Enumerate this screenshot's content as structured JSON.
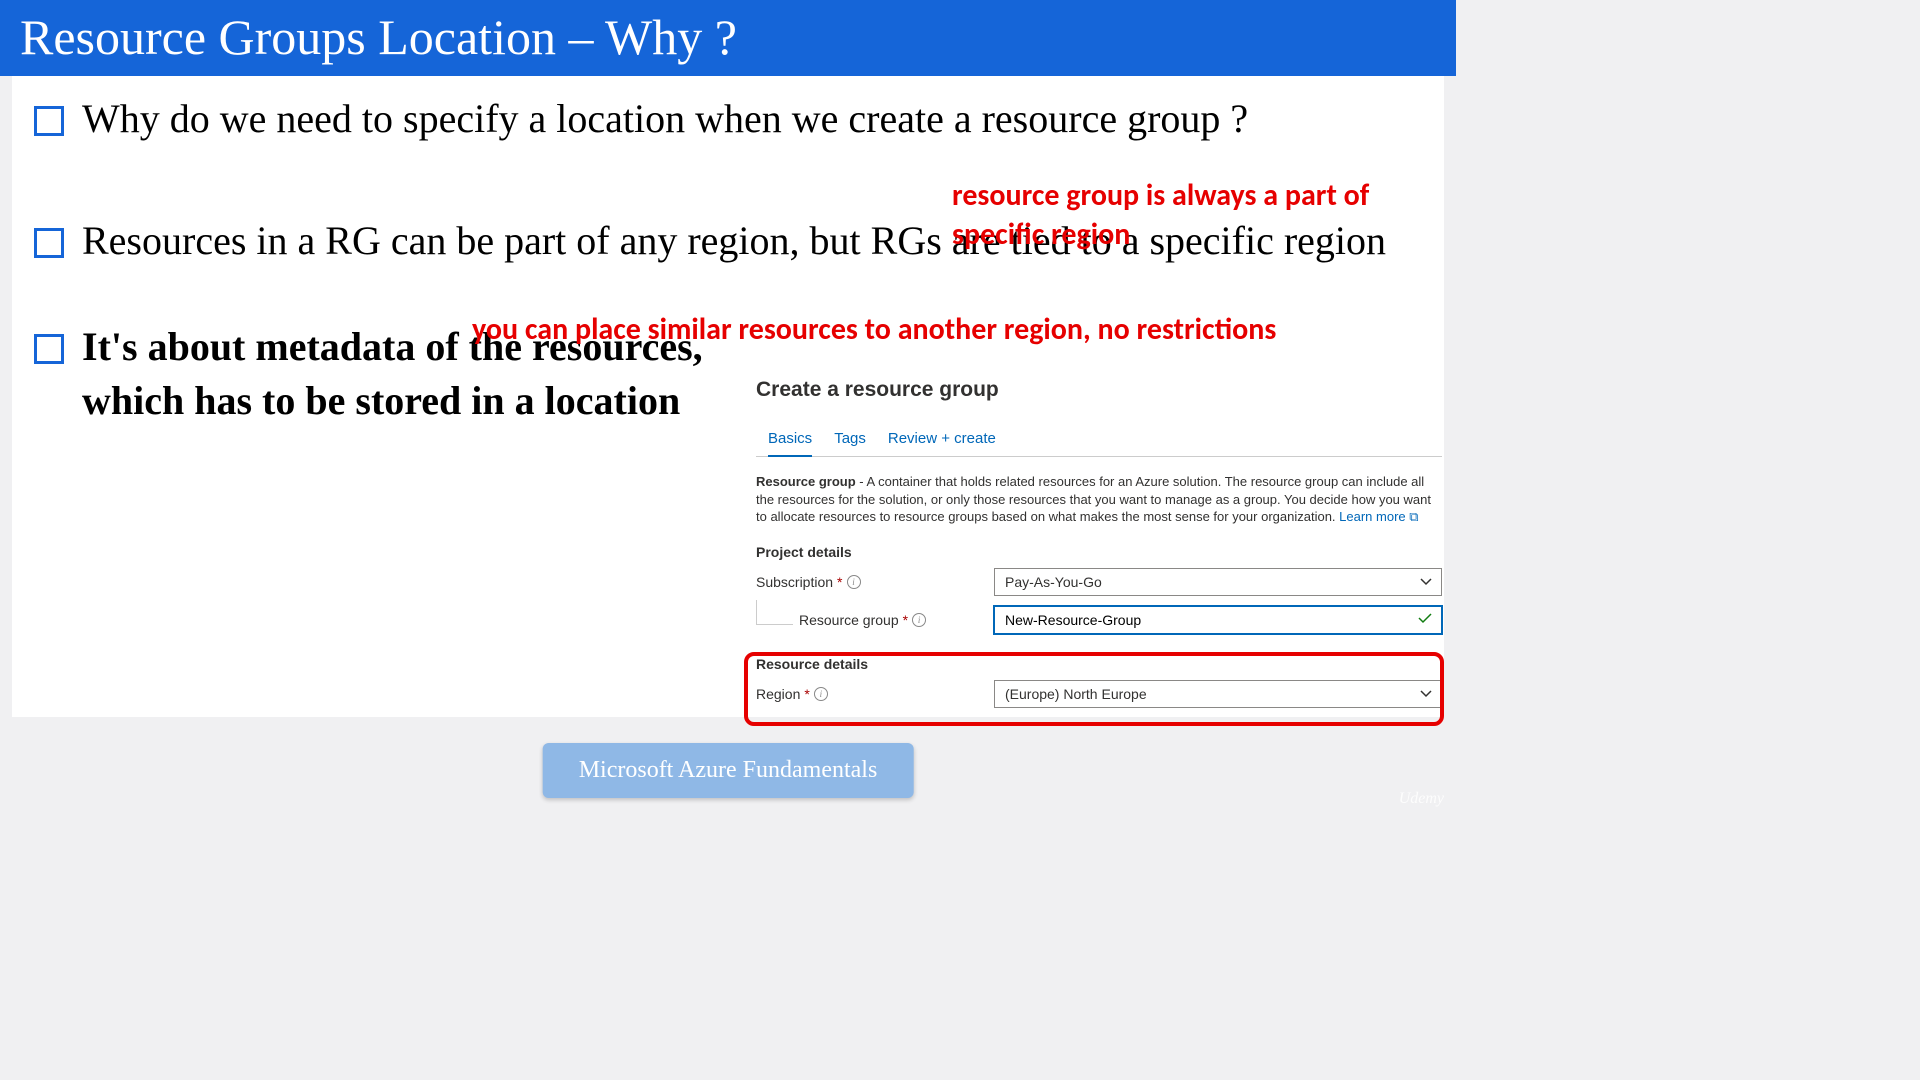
{
  "title": "Resource Groups Location – Why ?",
  "bullets": [
    "Why do we need to specify a location when we create a resource group ?",
    "Resources in a RG can be part of any region, but RGs are tied to a specific region",
    "It's about metadata of the resources, which has to be stored in a location"
  ],
  "annotations": {
    "top_right": "resource group is always a part of specific region",
    "middle": "you can place similar resources to another region, no restrictions"
  },
  "azure": {
    "heading": "Create a resource group",
    "tabs": [
      "Basics",
      "Tags",
      "Review + create"
    ],
    "desc_bold": "Resource group",
    "desc_rest": " - A container that holds related resources for an Azure solution. The resource group can include all the resources for the solution, or only those resources that you want to manage as a group. You decide how you want to allocate resources to resource groups based on what makes the most sense for your organization. ",
    "learn_more": "Learn more",
    "project_details": "Project details",
    "subscription_label": "Subscription",
    "subscription_value": "Pay-As-You-Go",
    "rg_label": "Resource group",
    "rg_value": "New-Resource-Group",
    "resource_details": "Resource details",
    "region_label": "Region",
    "region_value": "(Europe) North Europe"
  },
  "badge": "Microsoft Azure Fundamentals",
  "watermark": "Udemy"
}
